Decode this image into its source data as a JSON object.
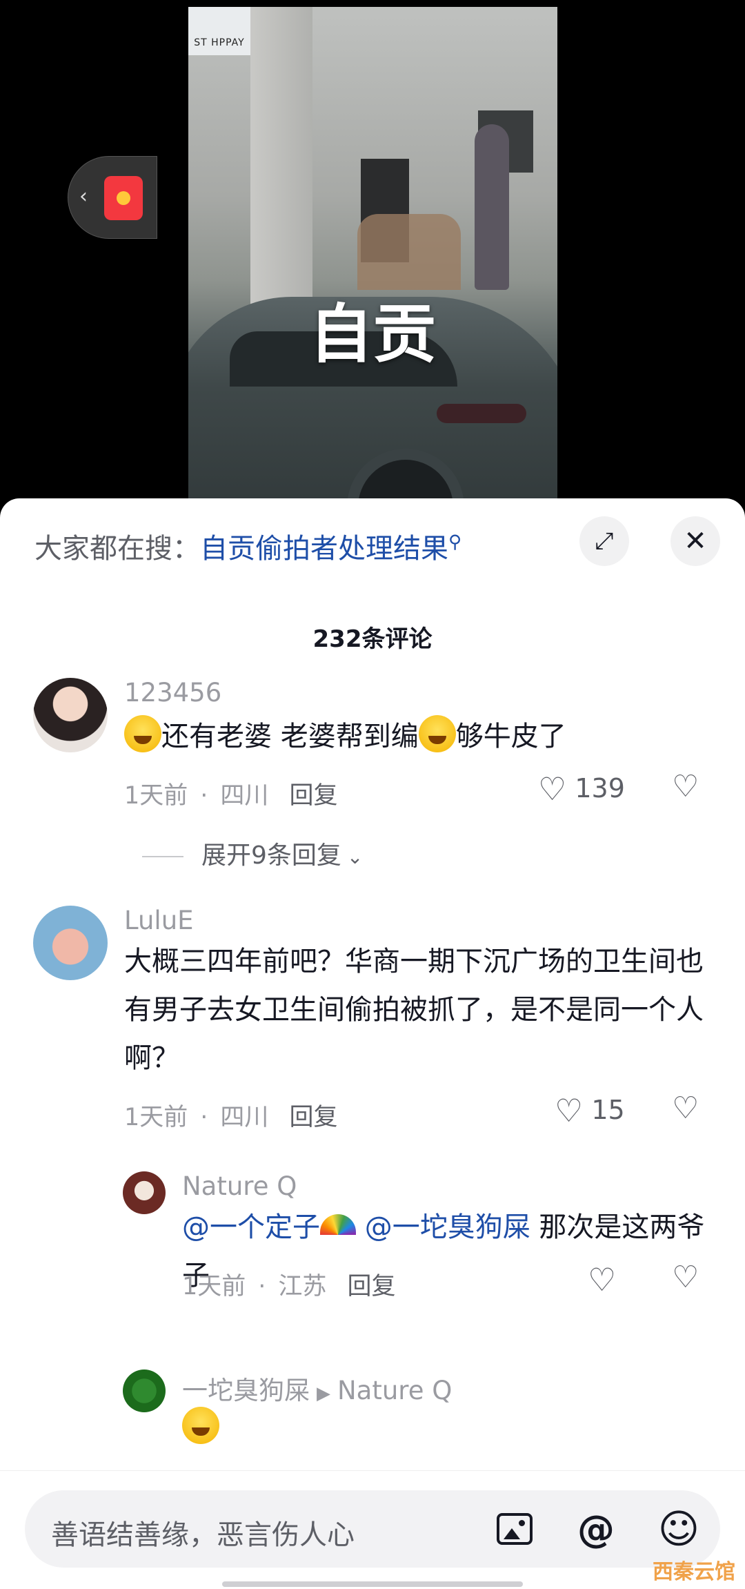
{
  "video": {
    "caption": "自贡",
    "shop_sign": "ST HPPAY"
  },
  "search": {
    "prefix": "大家都在搜：",
    "query": "自贡偷拍者处理结果"
  },
  "comments_header": {
    "count_label": "232条评论"
  },
  "comments": [
    {
      "username": "123456",
      "text": "还有老婆 老婆帮到编",
      "text_tail": "够牛皮了",
      "time": "1天前",
      "location": "四川",
      "reply_label": "回复",
      "likes": "139",
      "expand_label": "展开9条回复"
    },
    {
      "username": "LuluE",
      "text": "大概三四年前吧？华商一期下沉广场的卫生间也有男子去女卫生间偷拍被抓了，是不是同一个人啊？",
      "time": "1天前",
      "location": "四川",
      "reply_label": "回复",
      "likes": "15"
    }
  ],
  "replies": [
    {
      "username": "Nature Q",
      "mention1": "@一个定子",
      "mention2": "@一坨臭狗屎",
      "text": " 那次是这两爷子",
      "time": "1天前",
      "location": "江苏",
      "reply_label": "回复"
    },
    {
      "username": "一坨臭狗屎",
      "reply_to": "Nature Q"
    }
  ],
  "input": {
    "placeholder": "善语结善缘，恶言伤人心"
  },
  "watermark": "西秦云馆",
  "icons": {
    "search_query": "search-icon",
    "expand": "expand-icon",
    "close": "close-icon",
    "like": "heart-icon",
    "dislike": "broken-heart-icon",
    "image": "image-icon",
    "mention": "at-icon",
    "emoji": "smile-icon"
  },
  "colors": {
    "link": "#1e4ea8",
    "secondary_text": "#9a9ba1",
    "red_packet": "#f3383f"
  }
}
